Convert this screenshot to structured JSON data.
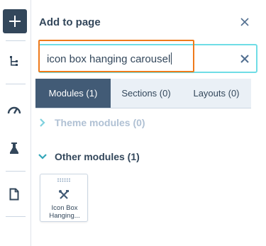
{
  "rail": {
    "icons": [
      "plus-icon",
      "tree-icon",
      "gauge-icon",
      "flask-icon",
      "document-icon"
    ]
  },
  "panel": {
    "title": "Add to page"
  },
  "search": {
    "value": "icon box hanging carousel"
  },
  "tabs": [
    {
      "label": "Modules (1)",
      "active": true
    },
    {
      "label": "Sections (0)",
      "active": false
    },
    {
      "label": "Layouts (0)",
      "active": false
    }
  ],
  "sections": {
    "theme": {
      "label": "Theme modules (0)",
      "expanded": false
    },
    "other": {
      "label": "Other modules (1)",
      "expanded": true
    }
  },
  "modules": [
    {
      "label_line1": "Icon Box",
      "label_line2": "Hanging..."
    }
  ],
  "colors": {
    "rail_button": "#33475b",
    "active_tab": "#425b76",
    "search_border": "#6fdde6",
    "highlight": "#ef7a1b",
    "muted_section": "#b0c1d4"
  }
}
